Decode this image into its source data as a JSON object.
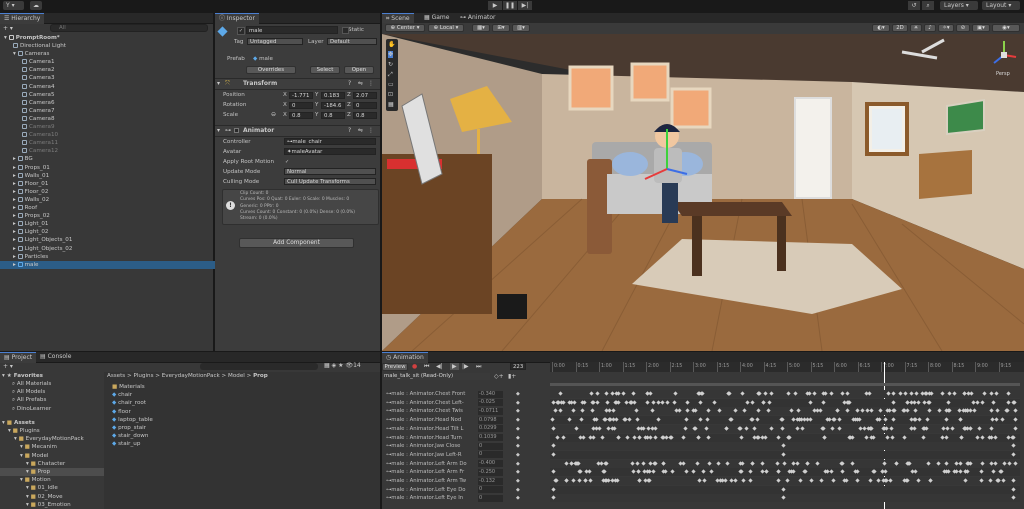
{
  "toolbar": {
    "account_label": "Y",
    "layers_label": "Layers",
    "layout_label": "Layout"
  },
  "hierarchy": {
    "tab": "Hierarchy",
    "search_placeholder": "All",
    "scene": "PromptRoom*",
    "items": [
      {
        "label": "Directional Light",
        "indent": 1,
        "dim": false
      },
      {
        "label": "Cameras",
        "indent": 1,
        "dim": false
      },
      {
        "label": "Camera1",
        "indent": 2,
        "dim": false
      },
      {
        "label": "Camera2",
        "indent": 2,
        "dim": false
      },
      {
        "label": "Camera3",
        "indent": 2,
        "dim": false
      },
      {
        "label": "Camera4",
        "indent": 2,
        "dim": false
      },
      {
        "label": "Camera5",
        "indent": 2,
        "dim": false
      },
      {
        "label": "Camera6",
        "indent": 2,
        "dim": false
      },
      {
        "label": "Camera7",
        "indent": 2,
        "dim": false
      },
      {
        "label": "Camera8",
        "indent": 2,
        "dim": false
      },
      {
        "label": "Camera9",
        "indent": 2,
        "dim": true
      },
      {
        "label": "Camera10",
        "indent": 2,
        "dim": true
      },
      {
        "label": "Camera11",
        "indent": 2,
        "dim": true
      },
      {
        "label": "Camera12",
        "indent": 2,
        "dim": true
      },
      {
        "label": "BG",
        "indent": 1,
        "dim": false
      },
      {
        "label": "Props_01",
        "indent": 1,
        "dim": false
      },
      {
        "label": "Walls_01",
        "indent": 1,
        "dim": false
      },
      {
        "label": "Floor_01",
        "indent": 1,
        "dim": false
      },
      {
        "label": "Floor_02",
        "indent": 1,
        "dim": false
      },
      {
        "label": "Walls_02",
        "indent": 1,
        "dim": false
      },
      {
        "label": "Roof",
        "indent": 1,
        "dim": false
      },
      {
        "label": "Props_02",
        "indent": 1,
        "dim": false
      },
      {
        "label": "Light_01",
        "indent": 1,
        "dim": false
      },
      {
        "label": "Light_02",
        "indent": 1,
        "dim": false
      },
      {
        "label": "Light_Objects_01",
        "indent": 1,
        "dim": false
      },
      {
        "label": "Light_Objects_02",
        "indent": 1,
        "dim": false
      },
      {
        "label": "Particles",
        "indent": 1,
        "dim": false
      },
      {
        "label": "male",
        "indent": 1,
        "dim": false,
        "selected": true
      }
    ]
  },
  "inspector": {
    "tab": "Inspector",
    "object_name": "male",
    "static_label": "Static",
    "tag_label": "Tag",
    "tag_value": "Untagged",
    "layer_label": "Layer",
    "layer_value": "Default",
    "prefab_label": "Prefab",
    "prefab_value": "male",
    "overrides_label": "Overrides",
    "select_label": "Select",
    "open_label": "Open",
    "transform": {
      "title": "Transform",
      "position_label": "Position",
      "rotation_label": "Rotation",
      "scale_label": "Scale",
      "pos": {
        "x": "-1.771",
        "y": "0.183",
        "z": "2.07"
      },
      "rot": {
        "x": "0",
        "y": "-184.6",
        "z": "0"
      },
      "scl": {
        "x": "0.8",
        "y": "0.8",
        "z": "0.8"
      }
    },
    "animator": {
      "title": "Animator",
      "controller_label": "Controller",
      "controller_value": "male_chair",
      "avatar_label": "Avatar",
      "avatar_value": "maleAvatar",
      "root_motion_label": "Apply Root Motion",
      "update_mode_label": "Update Mode",
      "update_mode_value": "Normal",
      "culling_label": "Culling Mode",
      "culling_value": "Cull Update Transforms",
      "info_lines": [
        "Clip Count: 0",
        "Curves Pos: 0 Quat: 0 Euler: 0 Scale: 0 Muscles: 0",
        "Generic: 0 PPtr: 0",
        "Curves Count: 0 Constant: 0 (0.0%) Dense: 0 (0.0%)",
        "Stream: 0 (0.0%)"
      ]
    },
    "add_component": "Add Component"
  },
  "scene_view": {
    "tabs": [
      "Scene",
      "Game",
      "Animator"
    ],
    "pivot_label": "Center",
    "space_label": "Local",
    "mode_2d": "2D",
    "persp_label": "Persp"
  },
  "project": {
    "tabs": [
      "Project",
      "Console"
    ],
    "count_label": "14",
    "favorites_title": "Favorites",
    "favorites": [
      "All Materials",
      "All Models",
      "All Prefabs",
      "DinoLearner"
    ],
    "assets_title": "Assets",
    "tree": [
      {
        "label": "Plugins",
        "indent": 1
      },
      {
        "label": "EverydayMotionPack",
        "indent": 2
      },
      {
        "label": "Mecanim",
        "indent": 3
      },
      {
        "label": "Model",
        "indent": 3
      },
      {
        "label": "Chatacter",
        "indent": 4
      },
      {
        "label": "Prop",
        "indent": 4,
        "selected": true
      },
      {
        "label": "Motion",
        "indent": 3
      },
      {
        "label": "01_Idle",
        "indent": 4
      },
      {
        "label": "02_Move",
        "indent": 4
      },
      {
        "label": "03_Emotion",
        "indent": 4
      }
    ],
    "breadcrumb": [
      "Assets",
      "Plugins",
      "EverydayMotionPack",
      "Model",
      "Prop"
    ],
    "files": [
      "Materials",
      "chair",
      "chair_root",
      "floor",
      "laptop_table",
      "prop_stair",
      "stair_down",
      "stair_up"
    ]
  },
  "animation": {
    "tab": "Animation",
    "preview_label": "Preview",
    "frame_value": "223",
    "clip_name": "male_talk_sit (Read-Only)",
    "ruler": [
      "0:00",
      "0:15",
      "1:00",
      "1:15",
      "2:00",
      "2:15",
      "3:00",
      "3:15",
      "4:00",
      "4:15",
      "5:00",
      "5:15",
      "6:00",
      "6:15",
      "7:00",
      "7:15",
      "8:00",
      "8:15",
      "9:00",
      "9:15"
    ],
    "tracks": [
      {
        "label": "male : Animator.Chest Front",
        "value": "-0.340"
      },
      {
        "label": "male : Animator.Chest Left-",
        "value": "-0.025"
      },
      {
        "label": "male : Animator.Chest Twis",
        "value": "-0.0711"
      },
      {
        "label": "male : Animator.Head Nod",
        "value": "0.0798"
      },
      {
        "label": "male : Animator.Head Tilt L",
        "value": "0.0299"
      },
      {
        "label": "male : Animator.Head Turn",
        "value": "0.1039"
      },
      {
        "label": "male : Animator.Jaw Close",
        "value": "0"
      },
      {
        "label": "male : Animator.Jaw Left-R",
        "value": "0"
      },
      {
        "label": "male : Animator.Left Arm Do",
        "value": "-0.400"
      },
      {
        "label": "male : Animator.Left Arm Fr",
        "value": "-0.250"
      },
      {
        "label": "male : Animator.Left Arm Tw",
        "value": "-0.132"
      },
      {
        "label": "male : Animator.Left Eye Do",
        "value": "0"
      },
      {
        "label": "male : Animator.Left Eye In",
        "value": "0"
      }
    ]
  }
}
